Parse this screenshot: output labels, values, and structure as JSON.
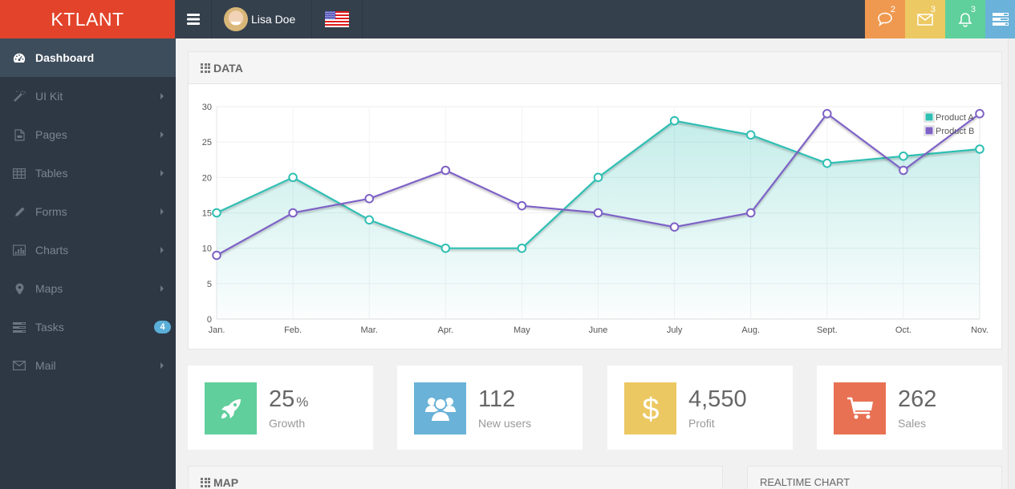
{
  "brand": "KTLANT",
  "topbar": {
    "user_name": "Lisa Doe",
    "language": "en-US",
    "buttons": [
      {
        "name": "chat",
        "icon": "chat-bubble-icon",
        "count": "2",
        "color": "#ef9950"
      },
      {
        "name": "mail",
        "icon": "envelope-icon",
        "count": "3",
        "color": "#ecc962"
      },
      {
        "name": "notifications",
        "icon": "bell-icon",
        "count": "3",
        "color": "#5fcf9b"
      },
      {
        "name": "tasks",
        "icon": "tasks-icon",
        "count": "",
        "color": "#6ab2d9"
      }
    ]
  },
  "sidebar": {
    "items": [
      {
        "label": "Dashboard",
        "icon": "dashboard-icon",
        "active": true
      },
      {
        "label": "UI Kit",
        "icon": "magic-wand-icon",
        "arrow": true
      },
      {
        "label": "Pages",
        "icon": "file-icon",
        "arrow": true
      },
      {
        "label": "Tables",
        "icon": "table-icon",
        "arrow": true
      },
      {
        "label": "Forms",
        "icon": "pencil-icon",
        "arrow": true
      },
      {
        "label": "Charts",
        "icon": "bar-chart-icon",
        "arrow": true
      },
      {
        "label": "Maps",
        "icon": "map-marker-icon",
        "arrow": true
      },
      {
        "label": "Tasks",
        "icon": "tasks-icon",
        "badge": "4"
      },
      {
        "label": "Mail",
        "icon": "envelope-icon",
        "arrow": true
      }
    ]
  },
  "data_panel": {
    "title": "DATA"
  },
  "chart_data": {
    "type": "line",
    "title": "",
    "xlabel": "",
    "ylabel": "",
    "categories": [
      "Jan.",
      "Feb.",
      "Mar.",
      "Apr.",
      "May",
      "June",
      "July",
      "Aug.",
      "Sept.",
      "Oct.",
      "Nov."
    ],
    "ylim": [
      0,
      30
    ],
    "yticks": [
      0,
      5,
      10,
      15,
      20,
      25,
      30
    ],
    "grid": true,
    "legend": "top-right",
    "series": [
      {
        "name": "Product A",
        "color": "#2fbfb3",
        "area": true,
        "values": [
          15,
          20,
          14,
          10,
          10,
          20,
          28,
          26,
          22,
          23,
          24
        ]
      },
      {
        "name": "Product B",
        "color": "#7e62c6",
        "area": false,
        "values": [
          9,
          15,
          17,
          21,
          16,
          15,
          13,
          15,
          29,
          21,
          29
        ]
      }
    ]
  },
  "stats": [
    {
      "value": "25",
      "unit": "%",
      "label": "Growth",
      "icon": "rocket-icon",
      "color": "#60cf9c"
    },
    {
      "value": "112",
      "unit": "",
      "label": "New users",
      "icon": "users-icon",
      "color": "#6ab2d7"
    },
    {
      "value": "4,550",
      "unit": "",
      "label": "Profit",
      "icon": "dollar-icon",
      "color": "#ecc862"
    },
    {
      "value": "262",
      "unit": "",
      "label": "Sales",
      "icon": "cart-icon",
      "color": "#e87154"
    }
  ],
  "map_panel": {
    "title": "MAP"
  },
  "realtime_panel": {
    "title": "REALTIME CHART"
  }
}
